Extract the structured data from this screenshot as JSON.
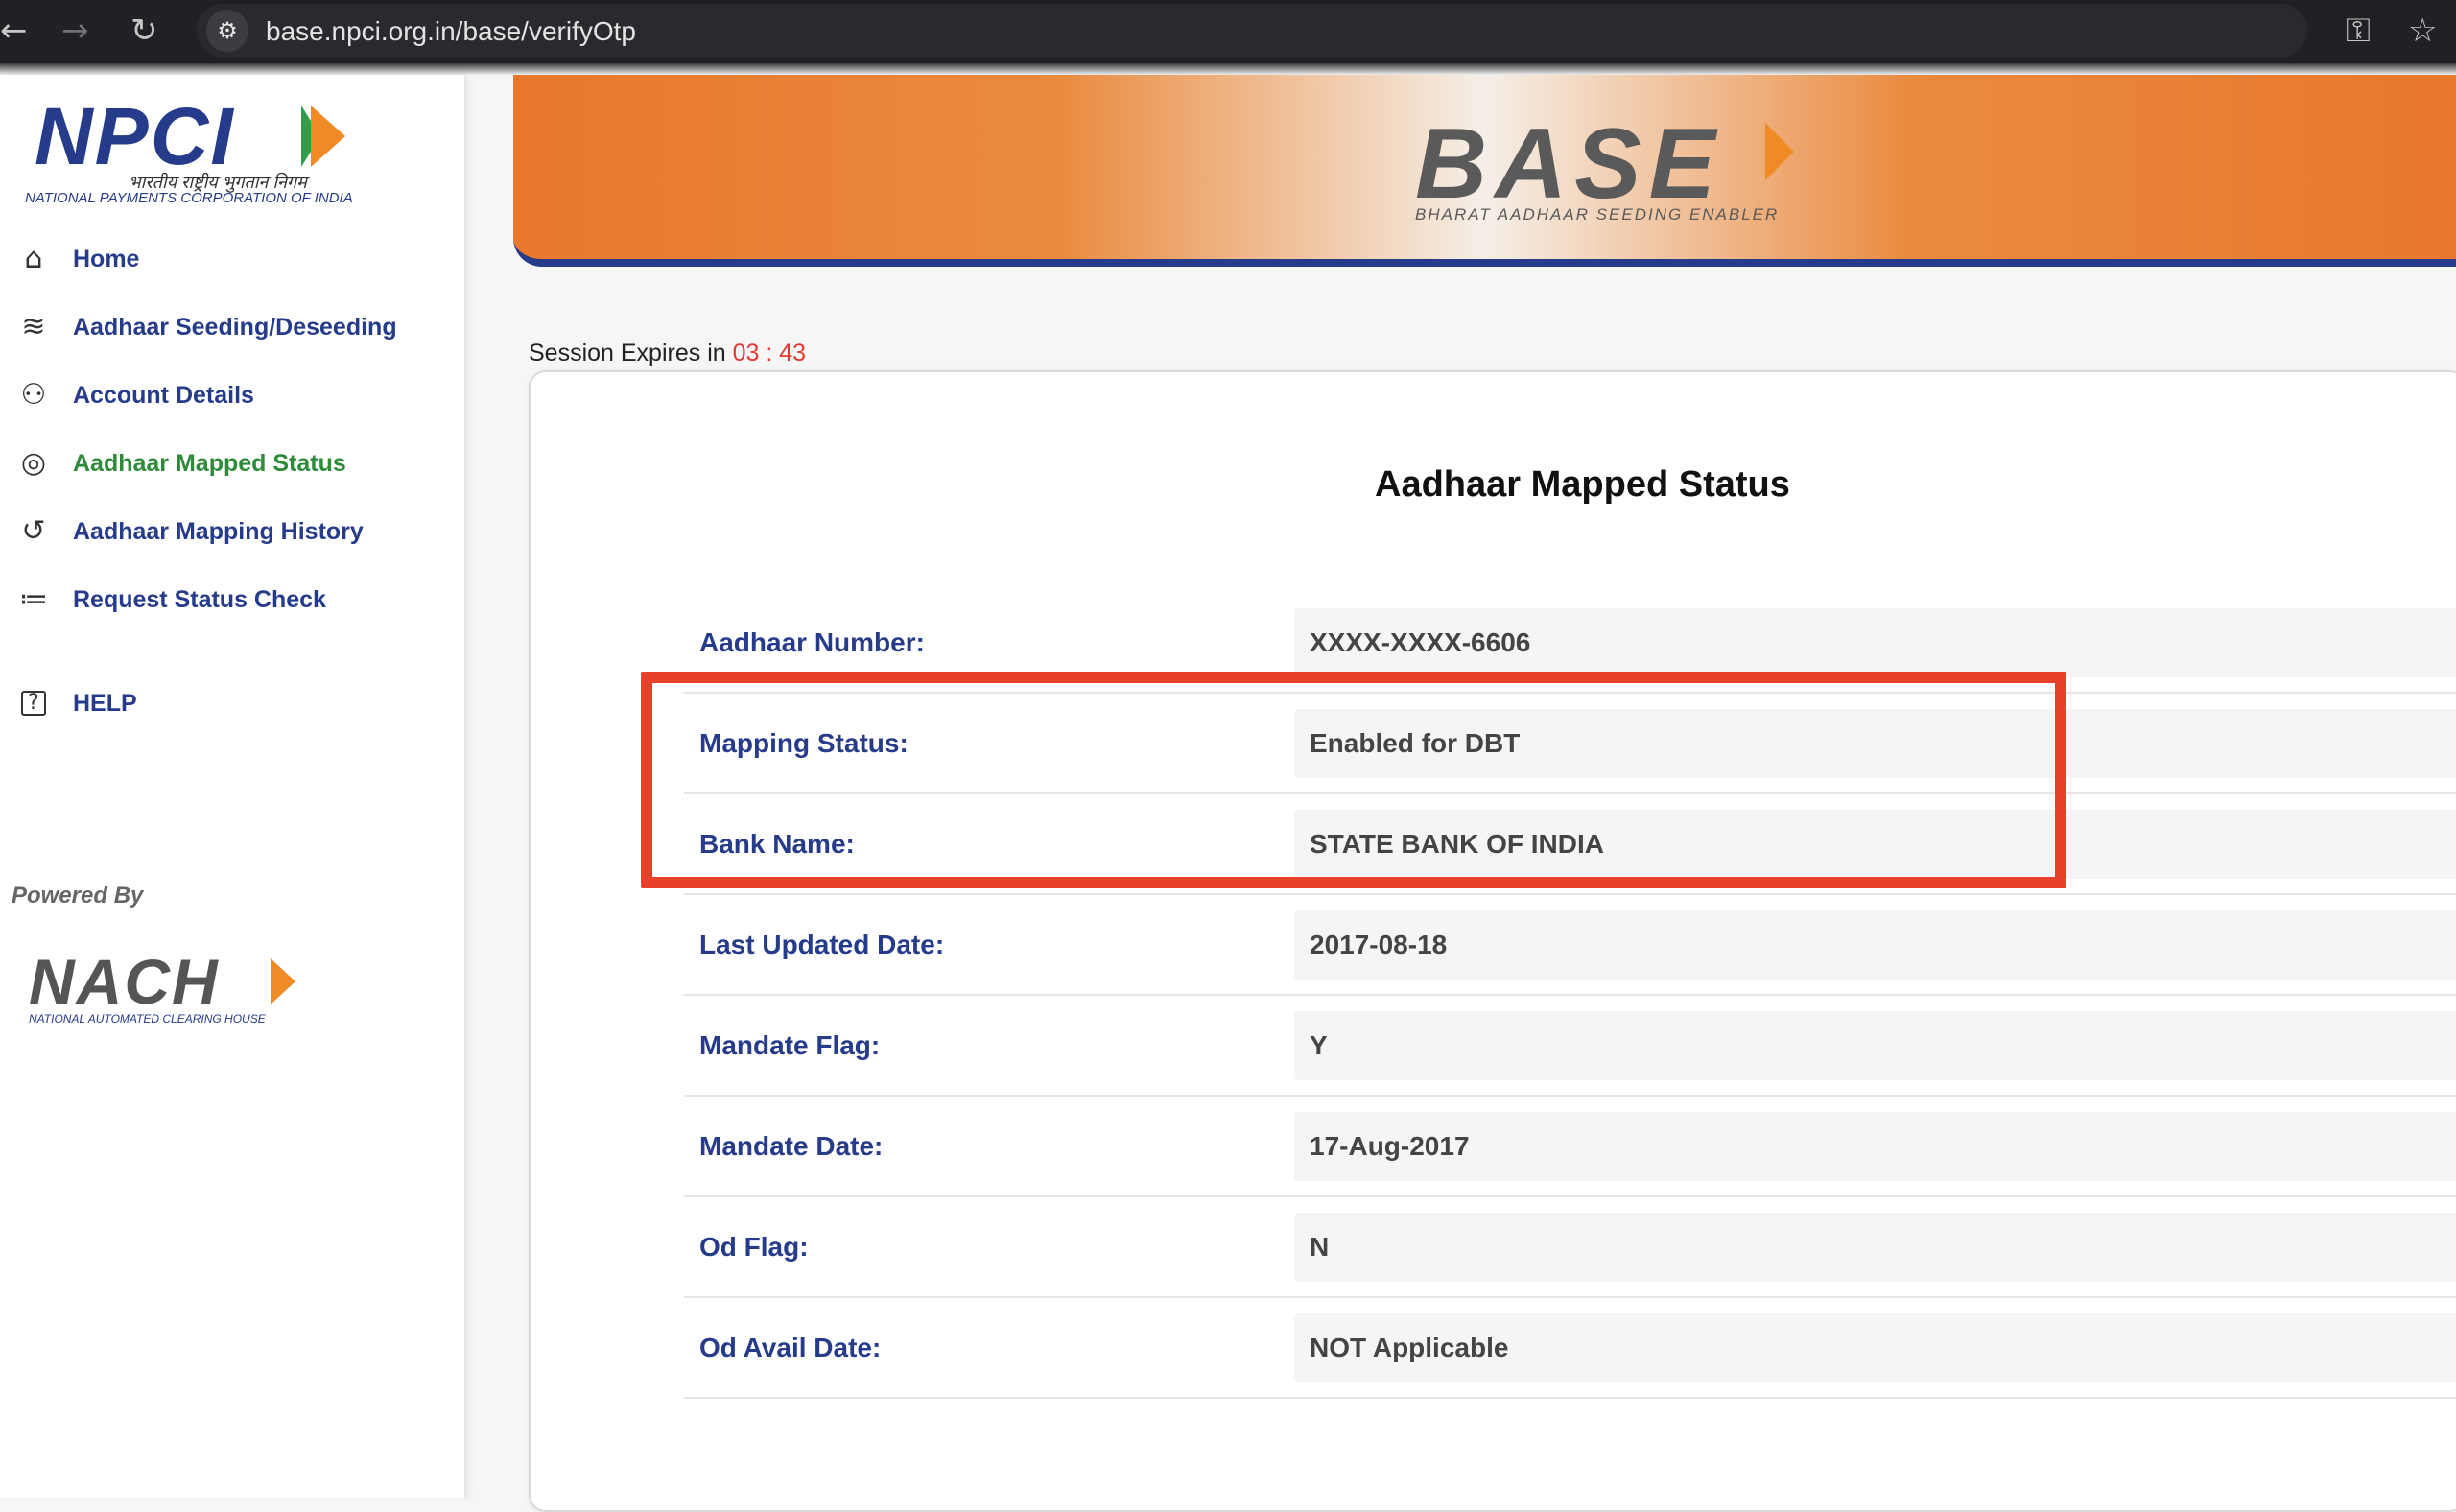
{
  "browser": {
    "url": "base.npci.org.in/base/verifyOtp",
    "back_glyph": "←",
    "forward_glyph": "→",
    "reload_glyph": "↻"
  },
  "sidebar": {
    "npci_logo_text": "NPCI",
    "npci_logo_hindi": "भारतीय राष्ट्रीय भुगतान निगम",
    "npci_logo_full": "NATIONAL PAYMENTS CORPORATION OF INDIA",
    "items": [
      {
        "label": "Home",
        "icon": "home-icon",
        "glyph": "⌂"
      },
      {
        "label": "Aadhaar Seeding/Deseeding",
        "icon": "fingerprint-icon",
        "glyph": "≋"
      },
      {
        "label": "Account Details",
        "icon": "users-icon",
        "glyph": "⚇"
      },
      {
        "label": "Aadhaar Mapped Status",
        "icon": "status-circle-icon",
        "glyph": "◎"
      },
      {
        "label": "Aadhaar Mapping History",
        "icon": "history-icon",
        "glyph": "↺"
      },
      {
        "label": "Request Status Check",
        "icon": "checklist-icon",
        "glyph": "≔"
      },
      {
        "label": "HELP",
        "icon": "help-icon",
        "glyph": "?"
      }
    ],
    "powered_by": "Powered By",
    "nach_logo_text": "NACH",
    "nach_logo_full": "NATIONAL AUTOMATED CLEARING HOUSE"
  },
  "banner": {
    "logo_text": "BASE",
    "tagline": "BHARAT AADHAAR SEEDING ENABLER"
  },
  "session": {
    "label": "Session Expires in",
    "timer": "03 : 43"
  },
  "main": {
    "title": "Aadhaar Mapped Status",
    "rows": [
      {
        "label": "Aadhaar Number:",
        "value": "XXXX-XXXX-6606"
      },
      {
        "label": "Mapping Status:",
        "value": "Enabled for DBT"
      },
      {
        "label": "Bank Name:",
        "value": "STATE BANK OF INDIA"
      },
      {
        "label": "Last Updated Date:",
        "value": "2017-08-18"
      },
      {
        "label": "Mandate Flag:",
        "value": "Y"
      },
      {
        "label": "Mandate Date:",
        "value": "17-Aug-2017"
      },
      {
        "label": "Od Flag:",
        "value": "N"
      },
      {
        "label": "Od Avail Date:",
        "value": "NOT Applicable"
      }
    ]
  },
  "colors": {
    "brand_blue": "#263b8a",
    "brand_orange": "#e8782d",
    "active_green": "#2e8b3a",
    "timer_red": "#e53935",
    "highlight_red": "#e8412a"
  }
}
